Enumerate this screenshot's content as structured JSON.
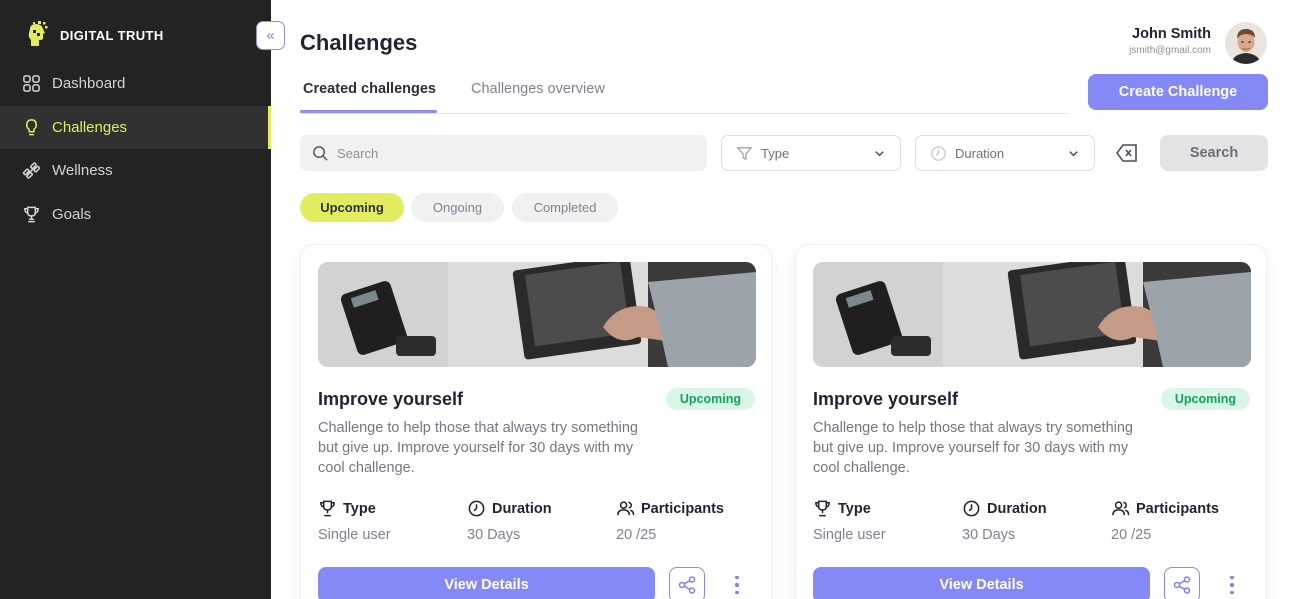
{
  "brand": {
    "name": "DIGITAL TRUTH"
  },
  "sidebar": {
    "items": [
      {
        "label": "Dashboard",
        "icon": "grid-icon",
        "active": false
      },
      {
        "label": "Challenges",
        "icon": "bulb-icon",
        "active": true
      },
      {
        "label": "Wellness",
        "icon": "dumbbell-icon",
        "active": false
      },
      {
        "label": "Goals",
        "icon": "trophy-icon",
        "active": false
      }
    ]
  },
  "header": {
    "title": "Challenges",
    "user_name": "John Smith",
    "user_email": "jsmith@gmail.com"
  },
  "tabs": [
    {
      "label": "Created challenges",
      "active": true
    },
    {
      "label": "Challenges overview",
      "active": false
    }
  ],
  "actions": {
    "create_label": "Create Challenge",
    "search_placeholder": "Search",
    "type_label": "Type",
    "duration_label": "Duration",
    "search_button": "Search"
  },
  "status_filters": [
    {
      "label": "Upcoming",
      "active": true
    },
    {
      "label": "Ongoing",
      "active": false
    },
    {
      "label": "Completed",
      "active": false
    }
  ],
  "cards": [
    {
      "title": "Improve yourself",
      "status": "Upcoming",
      "description": "Challenge to help those that always try something but give up. Improve yourself for 30 days with my cool challenge.",
      "type_label": "Type",
      "type_value": "Single user",
      "duration_label": "Duration",
      "duration_value": "30 Days",
      "participants_label": "Participants",
      "participants_value": "20 /25",
      "button_label": "View Details"
    },
    {
      "title": "Improve yourself",
      "status": "Upcoming",
      "description": "Challenge to help those that always try something but give up. Improve yourself for 30 days with my cool challenge.",
      "type_label": "Type",
      "type_value": "Single user",
      "duration_label": "Duration",
      "duration_value": "30 Days",
      "participants_label": "Participants",
      "participants_value": "20 /25",
      "button_label": "View Details"
    }
  ],
  "colors": {
    "sidebar_bg": "#232323",
    "accent_yellow": "#e3ec5e",
    "primary": "#8589f5",
    "badge_bg": "#d9f6e8",
    "badge_text": "#15a163"
  }
}
